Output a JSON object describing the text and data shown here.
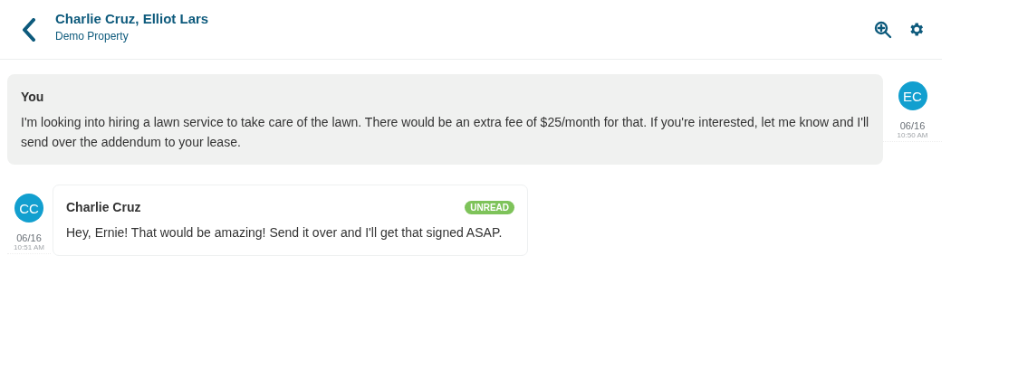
{
  "header": {
    "title": "Charlie Cruz, Elliot Lars",
    "subtitle": "Demo Property"
  },
  "messages": [
    {
      "kind": "outgoing",
      "sender": "You",
      "text": "I'm looking into hiring a lawn service to take care of the lawn. There would be an extra fee of $25/month for that. If you're interested, let me know and I'll send over the addendum to your lease.",
      "initials": "EC",
      "date": "06/16",
      "time": "10:50 AM"
    },
    {
      "kind": "incoming",
      "sender": "Charlie Cruz",
      "text": "Hey, Ernie! That would be amazing! Send it over and I'll get that signed ASAP.",
      "initials": "CC",
      "date": "06/16",
      "time": "10:51 AM",
      "unread": true,
      "badge": "UNREAD"
    }
  ]
}
